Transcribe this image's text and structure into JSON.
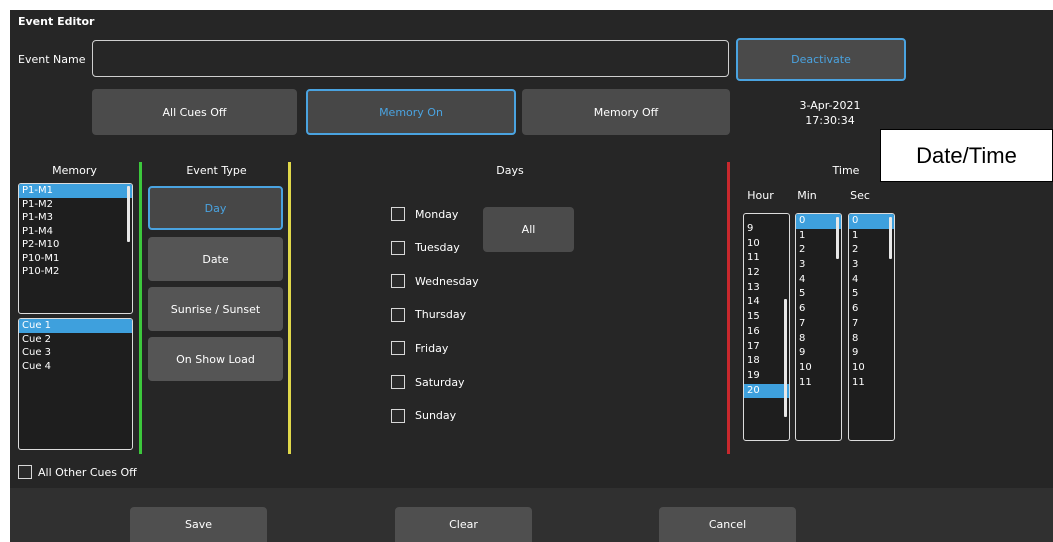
{
  "window": {
    "title": "Event Editor"
  },
  "event_name": {
    "label": "Event Name",
    "value": ""
  },
  "deactivate_label": "Deactivate",
  "action_buttons": {
    "all_cues_off": "All Cues Off",
    "memory_on": "Memory On",
    "memory_off": "Memory Off"
  },
  "datetime": {
    "date": "3-Apr-2021",
    "time": "17:30:34"
  },
  "callout": "Date/Time",
  "memory": {
    "header": "Memory",
    "items": [
      "P1-M1",
      "P1-M2",
      "P1-M3",
      "P1-M4",
      "P2-M10",
      "P10-M1",
      "P10-M2"
    ],
    "selected": "P1-M1"
  },
  "cues": {
    "items": [
      "Cue 1",
      "Cue 2",
      "Cue 3",
      "Cue 4"
    ],
    "selected": "Cue 1"
  },
  "all_other_cues_off": "All Other Cues Off",
  "event_type": {
    "header": "Event Type",
    "buttons": [
      "Day",
      "Date",
      "Sunrise / Sunset",
      "On Show Load"
    ],
    "selected": "Day"
  },
  "days": {
    "header": "Days",
    "all_label": "All",
    "items": [
      "Monday",
      "Tuesday",
      "Wednesday",
      "Thursday",
      "Friday",
      "Saturday",
      "Sunday"
    ]
  },
  "time": {
    "header": "Time",
    "hour": {
      "label": "Hour",
      "items": [
        "9",
        "10",
        "11",
        "12",
        "13",
        "14",
        "15",
        "16",
        "17",
        "18",
        "19",
        "20"
      ],
      "selected": "20"
    },
    "min": {
      "label": "Min",
      "items": [
        "0",
        "1",
        "2",
        "3",
        "4",
        "5",
        "6",
        "7",
        "8",
        "9",
        "10",
        "11"
      ],
      "selected": "0"
    },
    "sec": {
      "label": "Sec",
      "items": [
        "0",
        "1",
        "2",
        "3",
        "4",
        "5",
        "6",
        "7",
        "8",
        "9",
        "10",
        "11"
      ],
      "selected": "0"
    }
  },
  "footer": {
    "save": "Save",
    "clear": "Clear",
    "cancel": "Cancel"
  },
  "colors": {
    "accent": "#3ea0dd",
    "green_divider": "#3cc83c",
    "yellow_divider": "#e0d84a",
    "red_divider": "#c8282d"
  }
}
